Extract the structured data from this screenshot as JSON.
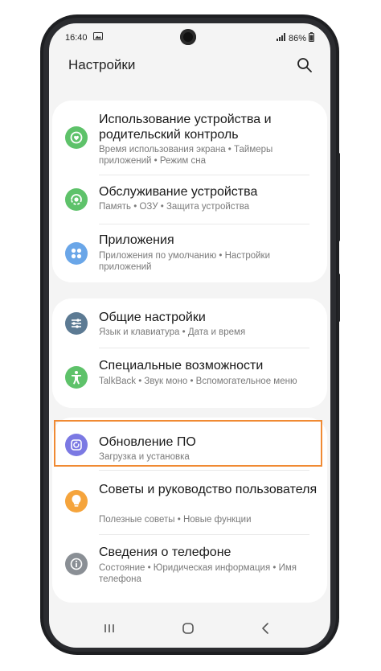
{
  "status": {
    "time": "16:40",
    "battery": "86%"
  },
  "header": {
    "title": "Настройки"
  },
  "colors": {
    "green": "#5ec26a",
    "blue": "#6aa6e8",
    "slate": "#5c7a93",
    "purple": "#7b79e3",
    "orange": "#f5a43c",
    "gray": "#8a8f95",
    "highlight": "#f08a33"
  },
  "groups": [
    {
      "items": [
        {
          "title": "Использование устройства и родительский контроль",
          "subtitle": "Время использования экрана • Таймеры приложений • Режим сна",
          "icon": "digital-wellbeing-icon"
        },
        {
          "title": "Обслуживание устройства",
          "subtitle": "Память • ОЗУ • Защита устройства",
          "icon": "device-care-icon"
        },
        {
          "title": "Приложения",
          "subtitle": "Приложения по умолчанию • Настройки приложений",
          "icon": "apps-icon"
        }
      ]
    },
    {
      "items": [
        {
          "title": "Общие настройки",
          "subtitle": "Язык и клавиатура • Дата и время",
          "icon": "sliders-icon"
        },
        {
          "title": "Специальные возможности",
          "subtitle": "TalkBack • Звук моно • Вспомогательное меню",
          "icon": "accessibility-icon"
        }
      ]
    },
    {
      "items": [
        {
          "title": "Обновление ПО",
          "subtitle": "Загрузка и установка",
          "icon": "software-update-icon"
        },
        {
          "title": "Советы и руководство пользователя",
          "subtitle": "Полезные советы • Новые функции",
          "icon": "tips-icon"
        },
        {
          "title": "Сведения о телефоне",
          "subtitle": "Состояние • Юридическая информация • Имя телефона",
          "icon": "about-phone-icon"
        }
      ]
    }
  ]
}
